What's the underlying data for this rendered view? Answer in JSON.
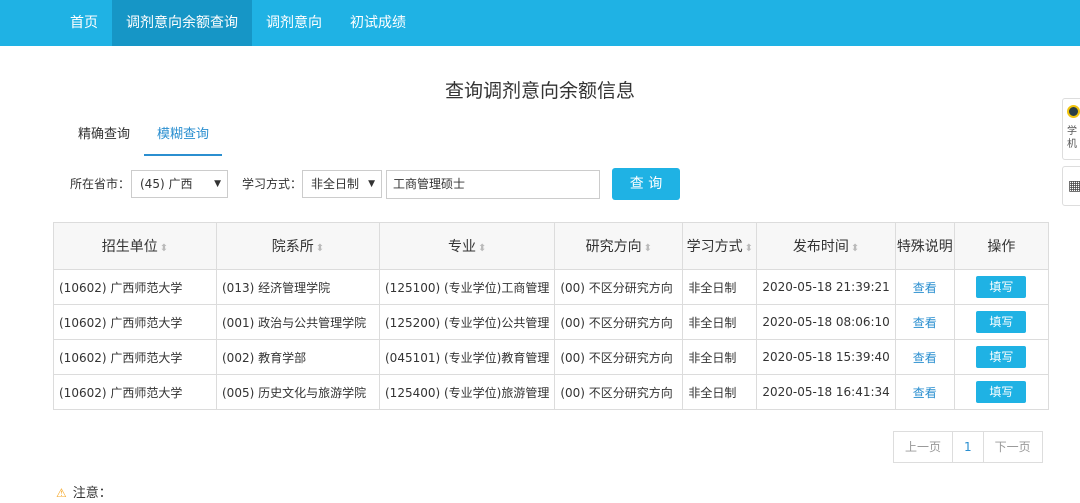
{
  "nav": {
    "items": [
      "首页",
      "调剂意向余额查询",
      "调剂意向",
      "初试成绩"
    ],
    "active_index": 1
  },
  "page_title": "查询调剂意向余额信息",
  "tabs": [
    "精确查询",
    "模糊查询"
  ],
  "active_tab": 1,
  "filters": {
    "province_label": "所在省市：",
    "province_value": "(45) 广西",
    "study_mode_label": "学习方式：",
    "study_mode_value": "非全日制",
    "keyword_value": "工商管理硕士",
    "query_button": "查 询"
  },
  "table": {
    "headers": [
      "招生单位",
      "院系所",
      "专业",
      "研究方向",
      "学习方式",
      "发布时间",
      "特殊说明",
      "操作"
    ],
    "sortable": [
      true,
      true,
      true,
      true,
      true,
      true,
      false,
      false
    ],
    "rows": [
      {
        "unit": "(10602) 广西师范大学",
        "dept": "(013) 经济管理学院",
        "major": "(125100) (专业学位)工商管理",
        "direction": "(00) 不区分研究方向",
        "mode": "非全日制",
        "time": "2020-05-18 21:39:21",
        "note": "查看",
        "action": "填写"
      },
      {
        "unit": "(10602) 广西师范大学",
        "dept": "(001) 政治与公共管理学院",
        "major": "(125200) (专业学位)公共管理",
        "direction": "(00) 不区分研究方向",
        "mode": "非全日制",
        "time": "2020-05-18 08:06:10",
        "note": "查看",
        "action": "填写"
      },
      {
        "unit": "(10602) 广西师范大学",
        "dept": "(002) 教育学部",
        "major": "(045101) (专业学位)教育管理",
        "direction": "(00) 不区分研究方向",
        "mode": "非全日制",
        "time": "2020-05-18 15:39:40",
        "note": "查看",
        "action": "填写"
      },
      {
        "unit": "(10602) 广西师范大学",
        "dept": "(005) 历史文化与旅游学院",
        "major": "(125400) (专业学位)旅游管理",
        "direction": "(00) 不区分研究方向",
        "mode": "非全日制",
        "time": "2020-05-18 16:41:34",
        "note": "查看",
        "action": "填写"
      }
    ]
  },
  "pagination": {
    "prev": "上一页",
    "current": "1",
    "next": "下一页"
  },
  "note_label": "注意：",
  "side_widget_text": "学机",
  "icons": {
    "sort": "sort-arrows-icon",
    "warning": "warning-triangle-icon",
    "qr": "qr-code-icon",
    "dropdown": "caret-down-icon"
  },
  "colors": {
    "primary": "#1fb2e4",
    "nav_active": "#1696c6",
    "link": "#2b8fd0",
    "warning": "#f5a623"
  }
}
